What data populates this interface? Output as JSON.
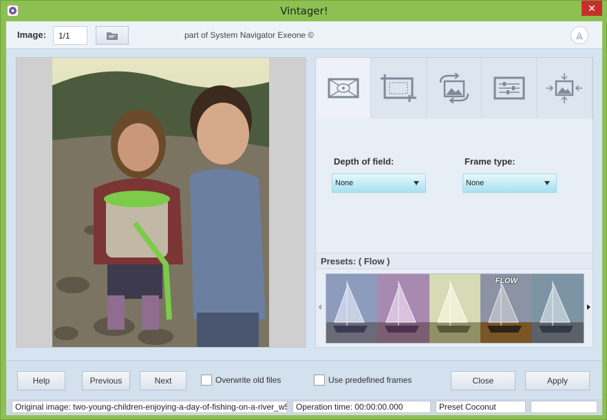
{
  "window": {
    "title": "Vintager!",
    "close_glyph": "✕",
    "app_icon": "vintager-app-icon"
  },
  "topbar": {
    "image_label": "Image:",
    "image_value": "1/1",
    "open_folder_icon": "folder-icon",
    "credit": "part of System Navigator Exeone ©",
    "logo_icon": "sail-logo-icon"
  },
  "tabs": [
    {
      "name": "vignette",
      "icon": "vignette-icon",
      "active": true
    },
    {
      "name": "crop",
      "icon": "crop-icon",
      "active": false
    },
    {
      "name": "rotate",
      "icon": "rotate-image-icon",
      "active": false
    },
    {
      "name": "adjust",
      "icon": "sliders-icon",
      "active": false
    },
    {
      "name": "resize",
      "icon": "resize-image-icon",
      "active": false
    }
  ],
  "options": {
    "depth_label": "Depth of field:",
    "depth_value": "None",
    "frame_label": "Frame type:",
    "frame_value": "None"
  },
  "presets": {
    "label": "Presets: ( Flow )",
    "items": [
      {
        "label": "",
        "tint": "#7a86a8"
      },
      {
        "label": "",
        "tint": "#9a7aa0"
      },
      {
        "label": "",
        "tint": "#b9c08a"
      },
      {
        "label": "FLOW",
        "tint": "#a06a3a"
      },
      {
        "label": "",
        "tint": "#6a8a9a"
      }
    ]
  },
  "buttons": {
    "help": "Help",
    "previous": "Previous",
    "next": "Next",
    "overwrite": "Overwrite old files",
    "predefined": "Use predefined frames",
    "close": "Close",
    "apply": "Apply"
  },
  "status": {
    "original": "Original image: two-young-children-enjoying-a-day-of-fishing-on-a-river_w544...",
    "operation": "Operation time: 00:00:00.000",
    "preset": "Preset Coconut",
    "extra": ""
  },
  "colors": {
    "accent": "#8cc152",
    "combo": "#bfeaf5"
  }
}
